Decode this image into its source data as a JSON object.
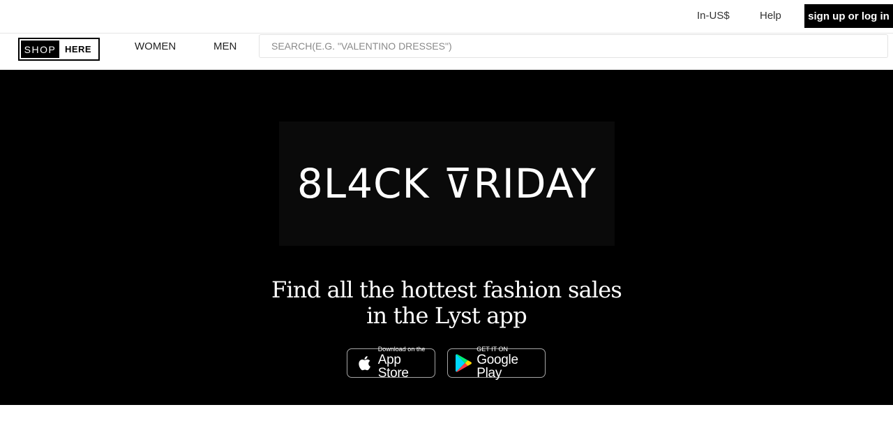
{
  "topbar": {
    "currency": "In-US$",
    "help": "Help",
    "signin": "sign up or log in"
  },
  "nav": {
    "logo_left": "SHOP",
    "logo_right": "HERE",
    "women": "WOMEN",
    "men": "MEN",
    "search_placeholder": "SEARCH(E.G. \"VALENTINO DRESSES\")"
  },
  "hero": {
    "title": "8L4CK ⊽RIDAY",
    "tagline_line1": "Find all the hottest fashion sales",
    "tagline_line2": "in the Lyst app",
    "app_store": {
      "small": "Download on the",
      "big": "App Store",
      "icon": "apple-icon"
    },
    "google_play": {
      "small": "GET IT ON",
      "big": "Google Play",
      "icon": "google-play-icon"
    }
  },
  "colors": {
    "hero_bg": "#000000",
    "signin_bg": "#000000",
    "text_on_dark": "#ffffff"
  }
}
